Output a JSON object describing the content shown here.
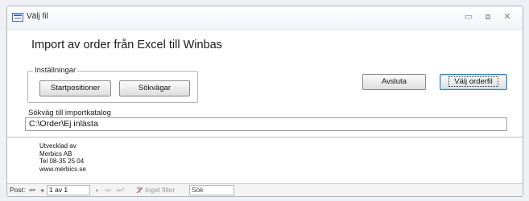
{
  "window": {
    "title": "Välj fil",
    "controls": {
      "minimize": "▭",
      "restore": "⧈",
      "close": "✕"
    }
  },
  "main": {
    "heading": "Import av order från Excel till Winbas",
    "settings_group": {
      "label": "Inställningar",
      "start_positions_label": "Startpositioner",
      "search_paths_label": "Sökvägar"
    },
    "cancel_label": "Avsluta",
    "choose_file_label": "Välj orderfil",
    "path_label": "Sökväg till importkatalog",
    "path_value": "C:\\Order\\Ej inlästa"
  },
  "footer_info": {
    "line1": "Utvecklad av",
    "line2": "Merbics AB",
    "line3": "Tel 08-35 25 04",
    "line4": "www.merbics.se"
  },
  "statusbar": {
    "record_label": "Post:",
    "first_icon": "⏮",
    "prev_icon": "◂",
    "record_position": "1 av 1",
    "next_icon": "▸",
    "last_icon": "⏭",
    "new_icon": "⏭*",
    "filter_label": "Inget filter",
    "search_label": "Sök"
  },
  "colors": {
    "accent": "#3c7fb1",
    "title_icon": "#3e6db5"
  }
}
